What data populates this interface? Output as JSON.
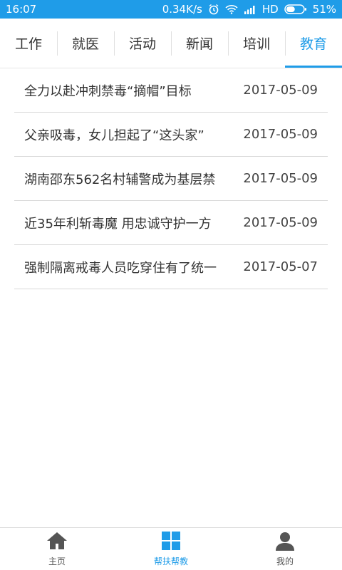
{
  "status_bar": {
    "time": "16:07",
    "net_speed": "0.34K/s",
    "hd": "HD",
    "battery": "51%",
    "battery_level": 0.51,
    "bg_color": "#1f9ce8"
  },
  "tabs": [
    {
      "label": "工作",
      "active": false
    },
    {
      "label": "就医",
      "active": false
    },
    {
      "label": "活动",
      "active": false
    },
    {
      "label": "新闻",
      "active": false
    },
    {
      "label": "培训",
      "active": false
    },
    {
      "label": "教育",
      "active": true
    }
  ],
  "articles": [
    {
      "title": "全力以赴冲刺禁毒“摘帽”目标",
      "date": "2017-05-09"
    },
    {
      "title": "父亲吸毒，女儿担起了“这头家”",
      "date": "2017-05-09"
    },
    {
      "title": "湖南邵东562名村辅警成为基层禁",
      "date": "2017-05-09"
    },
    {
      "title": "近35年利斩毒魔 用忠诚守护一方",
      "date": "2017-05-09"
    },
    {
      "title": "强制隔离戒毒人员吃穿住有了统一",
      "date": "2017-05-07"
    }
  ],
  "bottom_nav": [
    {
      "label": "主页",
      "icon": "home-icon",
      "active": false
    },
    {
      "label": "帮扶帮教",
      "icon": "grid-icon",
      "active": true
    },
    {
      "label": "我的",
      "icon": "person-icon",
      "active": false
    }
  ],
  "colors": {
    "accent": "#1f9ce8",
    "text": "#333333",
    "divider": "#d8d8d8",
    "inactive_icon": "#555555"
  }
}
